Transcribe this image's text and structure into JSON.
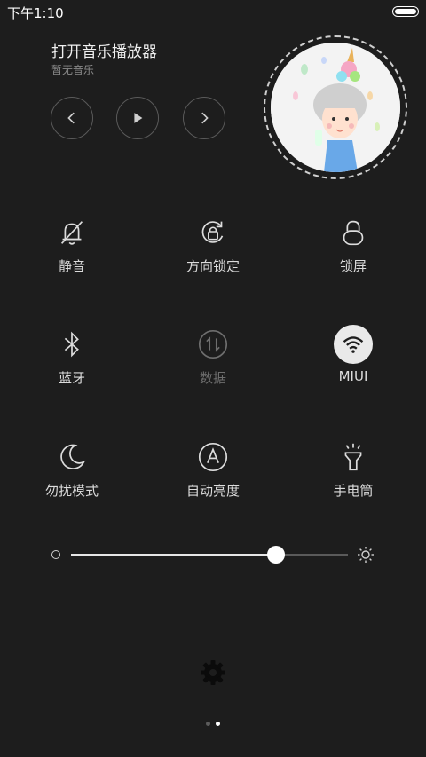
{
  "status_bar": {
    "time": "下午1:10"
  },
  "music": {
    "title": "打开音乐播放器",
    "subtitle": "暂无音乐",
    "controls": [
      "previous",
      "play",
      "next"
    ]
  },
  "toggles": [
    {
      "label": "静音",
      "icon": "bell-off-icon",
      "active": false
    },
    {
      "label": "方向锁定",
      "icon": "rotation-lock-icon",
      "active": false
    },
    {
      "label": "锁屏",
      "icon": "lock-icon",
      "active": false
    },
    {
      "label": "蓝牙",
      "icon": "bluetooth-icon",
      "active": false
    },
    {
      "label": "数据",
      "icon": "mobile-data-icon",
      "active": false,
      "disabled": true
    },
    {
      "label": "MIUI",
      "icon": "wifi-icon",
      "active": true
    },
    {
      "label": "勿扰模式",
      "icon": "moon-icon",
      "active": false
    },
    {
      "label": "自动亮度",
      "icon": "auto-brightness-icon",
      "active": false
    },
    {
      "label": "手电筒",
      "icon": "flashlight-icon",
      "active": false
    }
  ],
  "brightness": {
    "level": 0.74
  },
  "pager": {
    "pages": 2,
    "current": 2
  },
  "colors": {
    "background": "#1d1d1d",
    "text": "#dcdcdc",
    "disabled": "#6e6e6e",
    "active_bg": "#e9e9e9"
  }
}
